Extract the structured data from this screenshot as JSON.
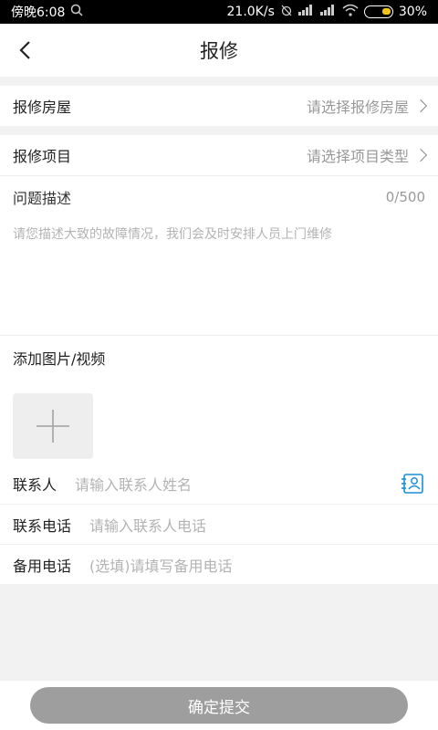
{
  "status_bar": {
    "time": "傍晚6:08",
    "speed": "21.0K/s",
    "battery": "30%"
  },
  "nav": {
    "title": "报修"
  },
  "house_row": {
    "label": "报修房屋",
    "placeholder": "请选择报修房屋"
  },
  "project_row": {
    "label": "报修项目",
    "placeholder": "请选择项目类型"
  },
  "description": {
    "label": "问题描述",
    "counter": "0/500",
    "placeholder": "请您描述大致的故障情况，我们会及时安排人员上门维修"
  },
  "media": {
    "label": "添加图片/视频"
  },
  "contact": {
    "name_label": "联系人",
    "name_placeholder": "请输入联系人姓名",
    "phone_label": "联系电话",
    "phone_placeholder": "请输入联系人电话",
    "backup_label": "备用电话",
    "backup_placeholder": "(选填)请填写备用电话"
  },
  "submit": {
    "label": "确定提交"
  },
  "colors": {
    "accent": "#1a8fd6",
    "submit_disabled": "#9e9e9e"
  }
}
